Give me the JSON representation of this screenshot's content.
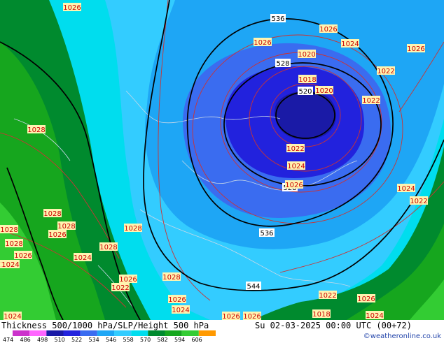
{
  "colors": {
    "c474": "#cc33cc",
    "c486": "#ff66ff",
    "c498": "#1a1aa6",
    "c510": "#2222dd",
    "c522": "#3a6cf0",
    "c534": "#1ea6f5",
    "c546": "#33ccff",
    "c558": "#00ddee",
    "c570": "#008a2e",
    "c582": "#16a61e",
    "c594": "#33cc33",
    "c606": "#ff9900",
    "contour_red": "#cc3333",
    "contour_black": "#000000",
    "label_bg": "#fff4b0",
    "label_text": "#cc0000"
  },
  "footer": {
    "title": "Thickness 500/1000 hPa/SLP/Height 500 hPa",
    "datetime": "Su 02-03-2025 00:00 UTC (00+72)",
    "credit": "©weatheronline.co.uk"
  },
  "legend": {
    "ticks": [
      "474",
      "486",
      "498",
      "510",
      "522",
      "534",
      "546",
      "558",
      "570",
      "582",
      "594",
      "606"
    ],
    "colors": [
      "#cc33cc",
      "#ff66ff",
      "#1a1aa6",
      "#2222dd",
      "#3a6cf0",
      "#1ea6f5",
      "#33ccff",
      "#00ddee",
      "#008a2e",
      "#16a61e",
      "#33cc33",
      "#ff9900"
    ]
  },
  "height_labels": [
    "536",
    "528",
    "520",
    "528",
    "536",
    "544"
  ],
  "slp_labels": [
    "1026",
    "1026",
    "1026",
    "1024",
    "1026",
    "1020",
    "1022",
    "1018",
    "1020",
    "1022",
    "1028",
    "1022",
    "1024",
    "1026",
    "1024",
    "1022",
    "1028",
    "1028",
    "1026",
    "1028",
    "1028",
    "1028",
    "1026",
    "1024",
    "1024",
    "1028",
    "1026",
    "1022",
    "1028",
    "1026",
    "1024",
    "1026",
    "1022",
    "1018",
    "1026",
    "1024",
    "1024",
    "1026",
    "1024"
  ]
}
